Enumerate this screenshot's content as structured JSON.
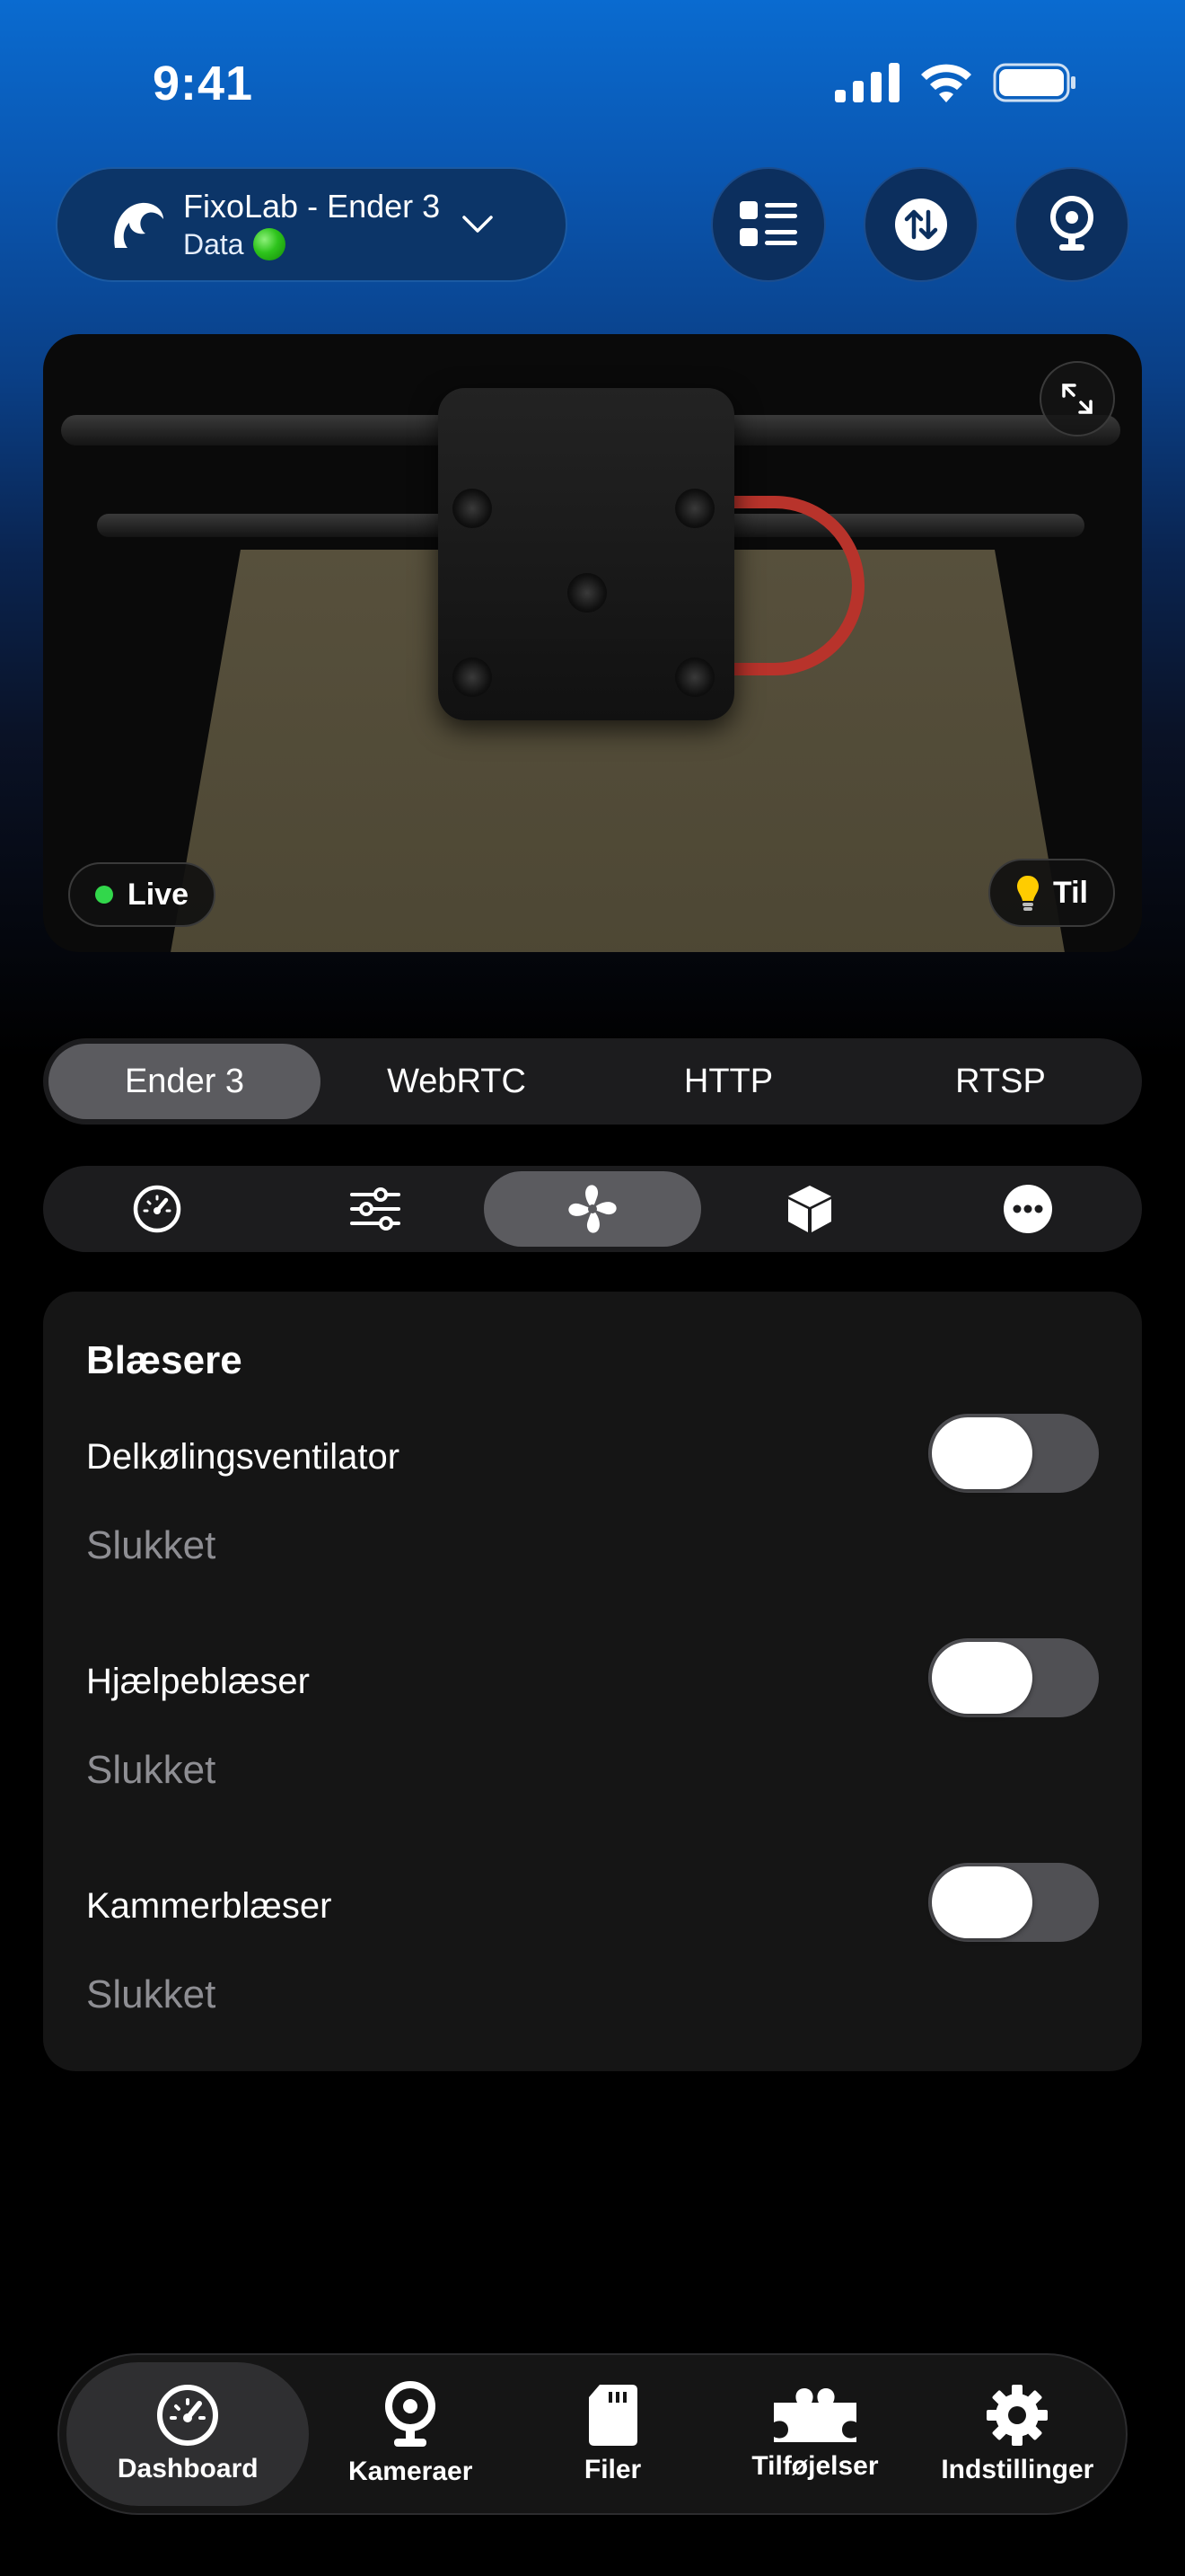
{
  "status_bar": {
    "time": "9:41"
  },
  "printer": {
    "name": "FixoLab - Ender 3",
    "subtitle": "Data"
  },
  "camera": {
    "live_label": "Live",
    "light_label": "Til"
  },
  "camera_sources": [
    {
      "label": "Ender 3",
      "active": true
    },
    {
      "label": "WebRTC",
      "active": false
    },
    {
      "label": "HTTP",
      "active": false
    },
    {
      "label": "RTSP",
      "active": false
    }
  ],
  "panel_tabs": [
    "gauge-icon",
    "sliders-icon",
    "fan-icon",
    "cube-icon",
    "more-icon"
  ],
  "fans": {
    "title": "Blæsere",
    "items": [
      {
        "name": "Delkølingsventilator",
        "status": "Slukket",
        "on": false
      },
      {
        "name": "Hjælpeblæser",
        "status": "Slukket",
        "on": false
      },
      {
        "name": "Kammerblæser",
        "status": "Slukket",
        "on": false
      }
    ]
  },
  "nav": {
    "dashboard": "Dashboard",
    "cameras": "Kameraer",
    "files": "Filer",
    "plugins": "Tilføjelser",
    "settings": "Indstillinger"
  }
}
